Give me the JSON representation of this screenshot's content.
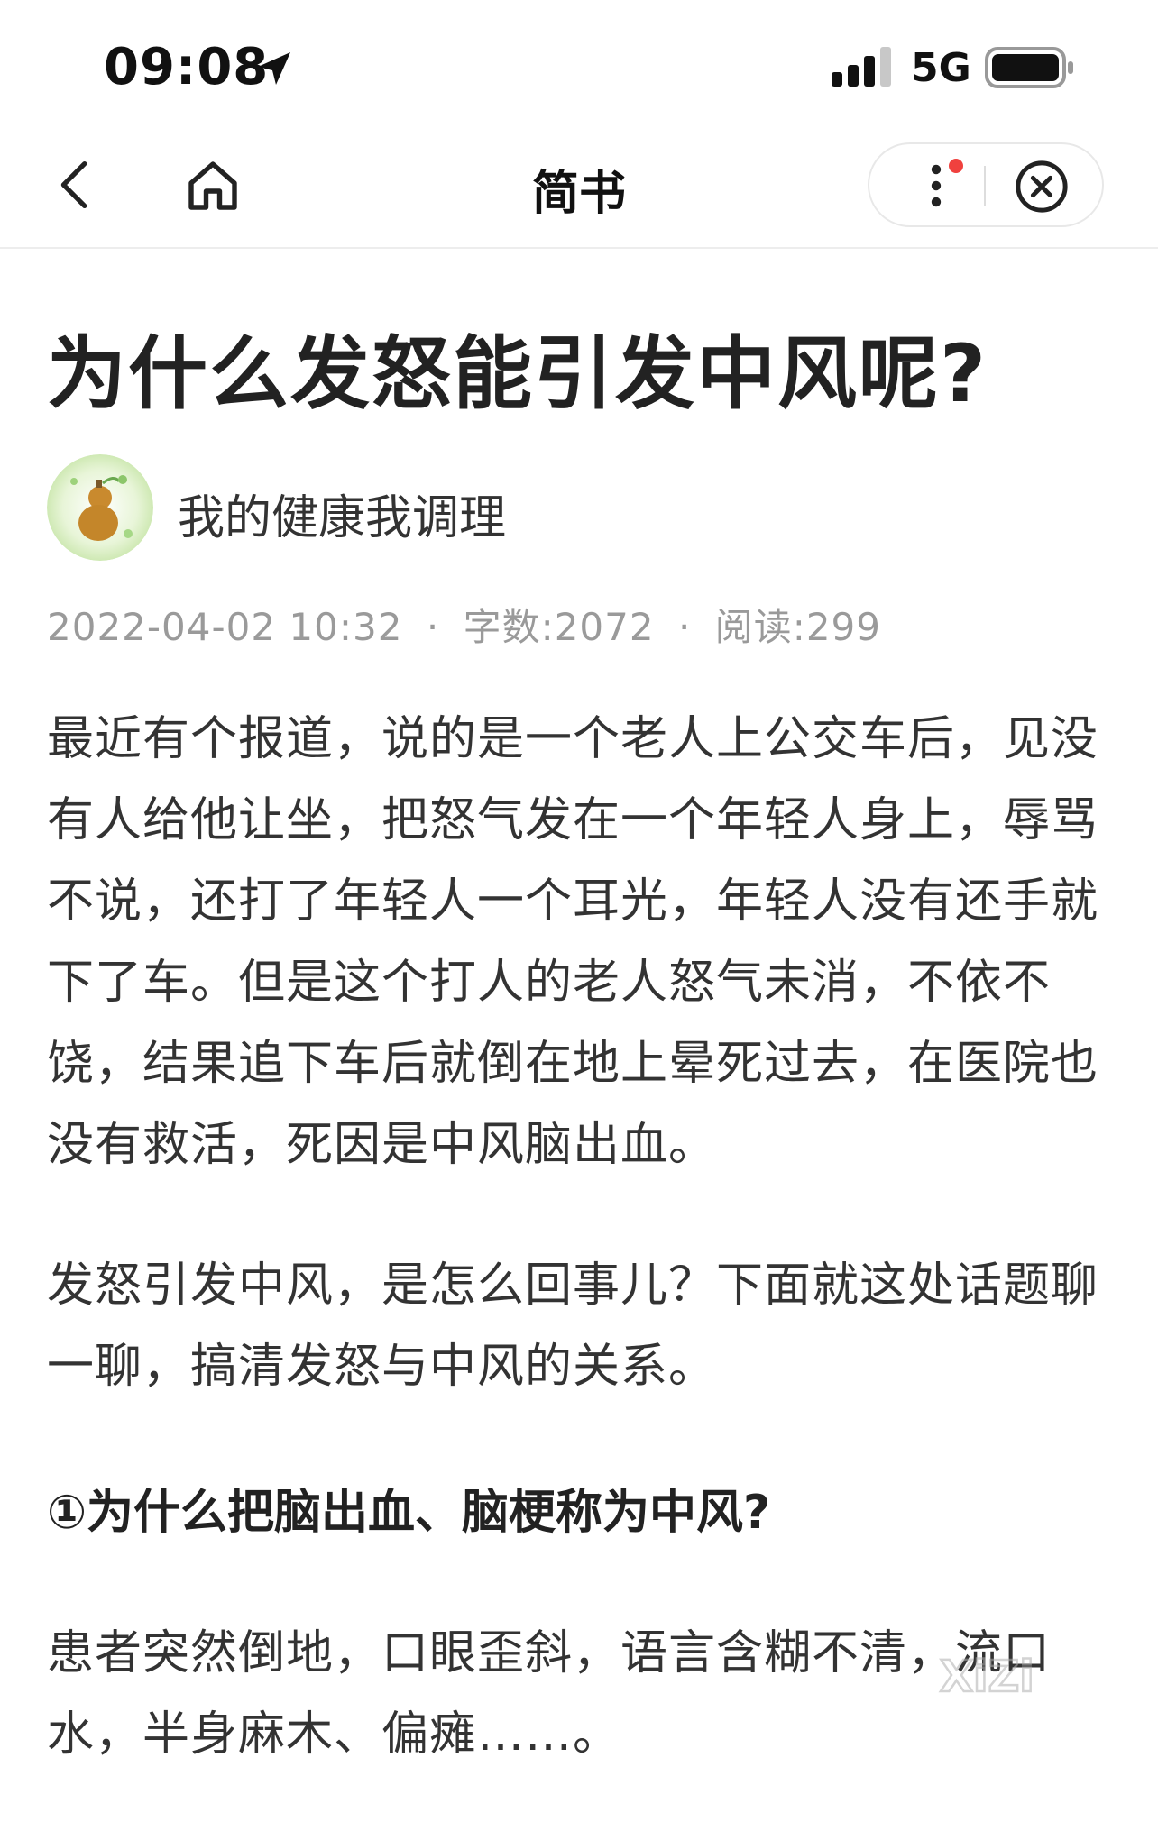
{
  "status_bar": {
    "time": "09:08",
    "network": "5G",
    "location_icon": "location-arrow-icon",
    "signal_icon": "cellular-signal-icon",
    "battery_icon": "battery-icon"
  },
  "nav": {
    "title": "简书",
    "back_icon": "chevron-left-icon",
    "home_icon": "home-icon",
    "more_icon": "more-vertical-icon",
    "close_icon": "close-circle-icon",
    "notification_dot_color": "#f0413e"
  },
  "article": {
    "title": "为什么发怒能引发中风呢?",
    "author": "我的健康我调理",
    "date": "2022-04-02 10:32",
    "word_count": "字数:2072",
    "reads": "阅读:299",
    "separator": "·",
    "paragraphs": [
      "最近有个报道，说的是一个老人上公交车后，见没有人给他让坐，把怒气发在一个年轻人身上，辱骂不说，还打了年轻人一个耳光，年轻人没有还手就下了车。但是这个打人的老人怒气未消，不依不饶，结果追下车后就倒在地上晕死过去，在医院也没有救活，死因是中风脑出血。",
      "发怒引发中风，是怎么回事儿？下面就这处话题聊一聊，搞清发怒与中风的关系。"
    ],
    "section_heading": "①为什么把脑出血、脑梗称为中风?",
    "section_paragraph": "患者突然倒地，口眼歪斜，语言含糊不清，流口水，半身麻木、偏瘫……。"
  },
  "watermark": {
    "text": "XiZi"
  }
}
